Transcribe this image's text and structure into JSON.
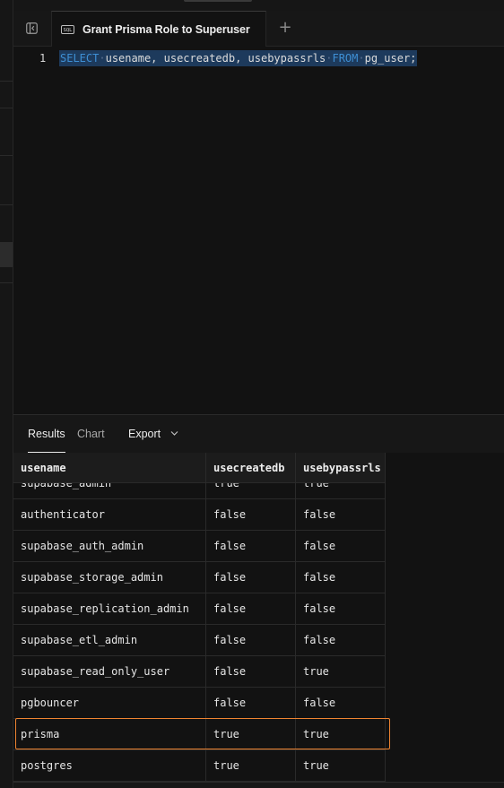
{
  "tab": {
    "title": "Grant Prisma Role to Superuser",
    "badge": "SQL"
  },
  "editor": {
    "line_number": "1",
    "query": {
      "kw_select": "SELECT",
      "columns": "usename, usecreatedb, usebypassrls",
      "kw_from": "FROM",
      "table": "pg_user;"
    }
  },
  "results_tabs": {
    "results": "Results",
    "chart": "Chart",
    "export": "Export"
  },
  "results": {
    "columns": [
      "usename",
      "usecreatedb",
      "usebypassrls"
    ],
    "rows": [
      [
        "supabase_admin",
        "true",
        "true"
      ],
      [
        "authenticator",
        "false",
        "false"
      ],
      [
        "supabase_auth_admin",
        "false",
        "false"
      ],
      [
        "supabase_storage_admin",
        "false",
        "false"
      ],
      [
        "supabase_replication_admin",
        "false",
        "false"
      ],
      [
        "supabase_etl_admin",
        "false",
        "false"
      ],
      [
        "supabase_read_only_user",
        "false",
        "true"
      ],
      [
        "pgbouncer",
        "false",
        "false"
      ],
      [
        "prisma",
        "true",
        "true"
      ],
      [
        "postgres",
        "true",
        "true"
      ]
    ],
    "highlighted_row": "prisma"
  },
  "colors": {
    "accent_highlight": "#ef8431",
    "keyword": "#3e8fd4",
    "selection": "#1d3a5c"
  }
}
